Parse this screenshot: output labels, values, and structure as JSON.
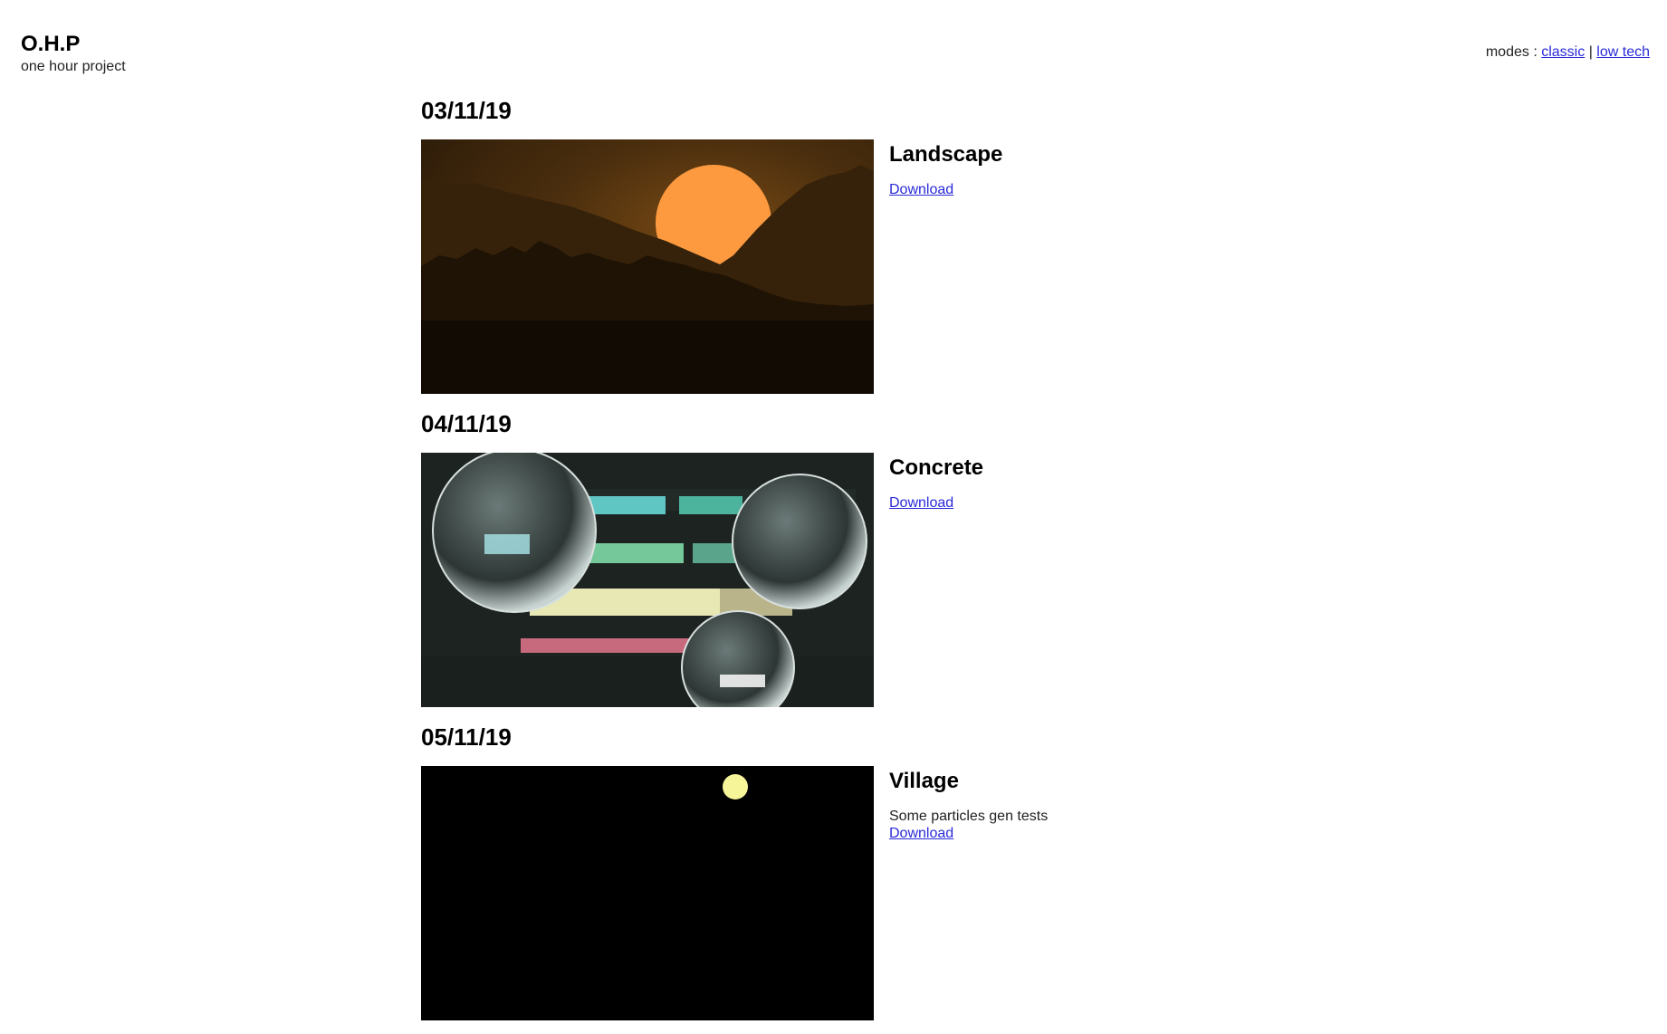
{
  "site": {
    "title": "O.H.P",
    "subtitle": "one hour project"
  },
  "modes": {
    "label": "modes :",
    "separator": "|",
    "options": [
      "classic",
      "low tech"
    ]
  },
  "entries": [
    {
      "date": "03/11/19",
      "title": "Landscape",
      "description": "",
      "download_label": "Download",
      "image": "landscape-sunset-render"
    },
    {
      "date": "04/11/19",
      "title": "Concrete",
      "description": "",
      "download_label": "Download",
      "image": "glass-spheres-concrete-render"
    },
    {
      "date": "05/11/19",
      "title": "Village",
      "description": "Some particles gen tests",
      "download_label": "Download",
      "image": "village-night-moon-render"
    }
  ],
  "colors": {
    "link": "#2a2ad8",
    "text": "#111111",
    "background": "#ffffff"
  }
}
